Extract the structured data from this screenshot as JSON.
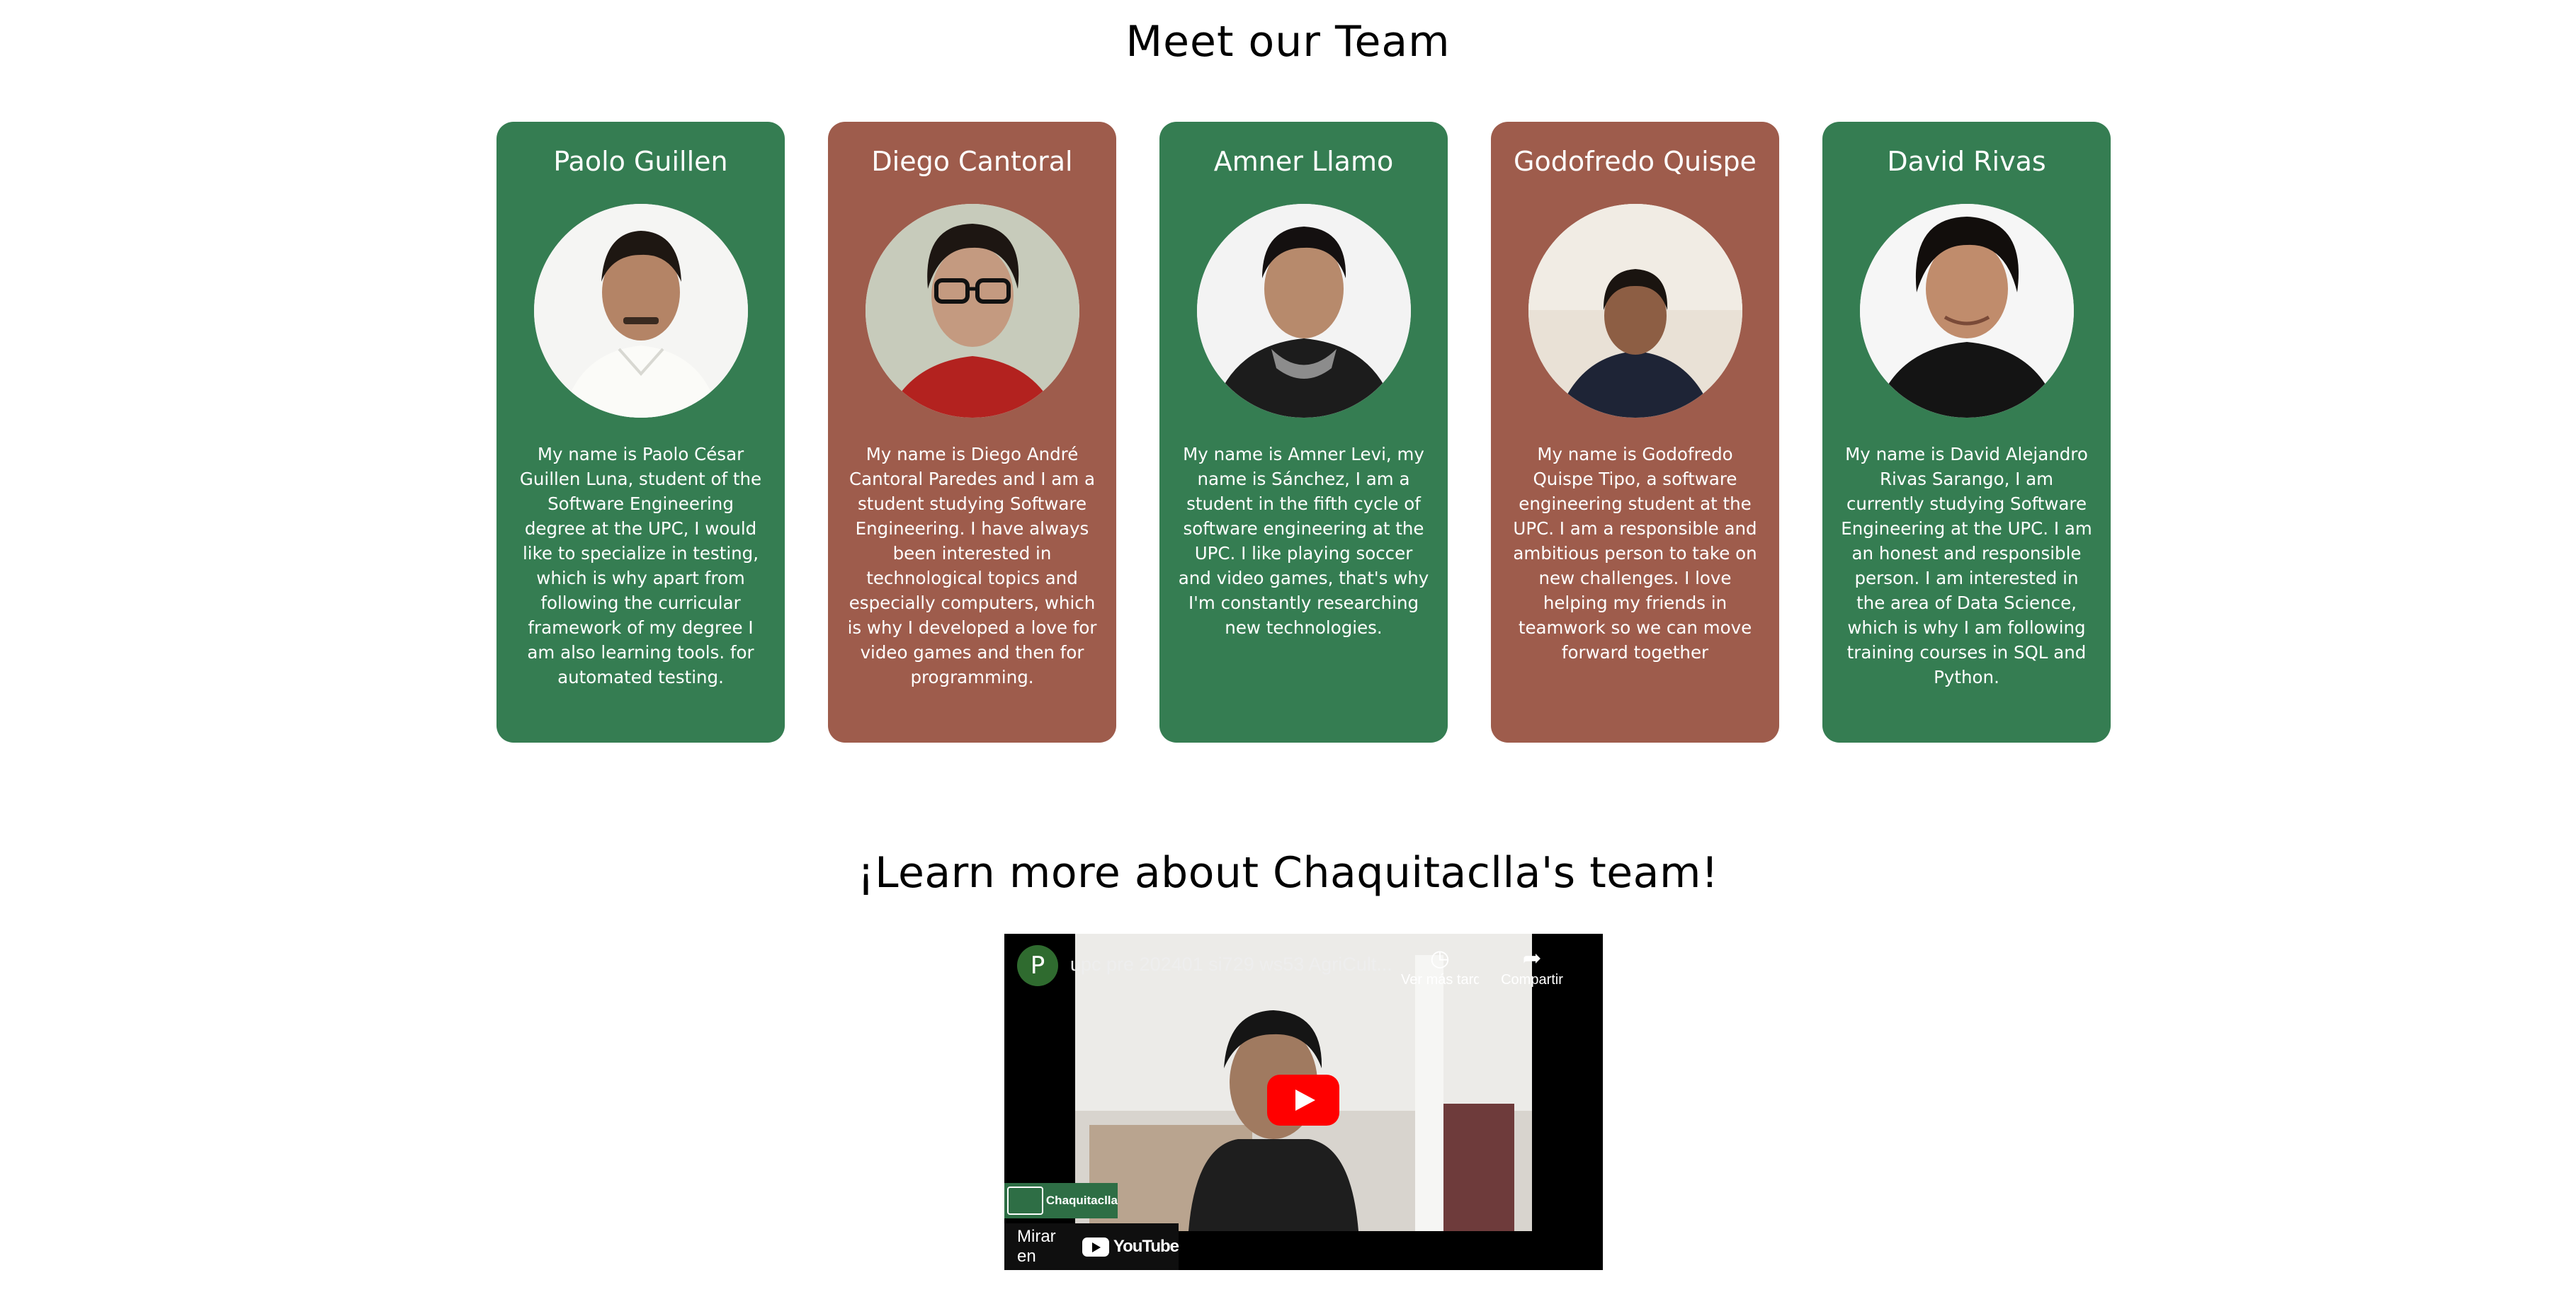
{
  "team_section": {
    "title": "Meet our Team",
    "members": [
      {
        "name": "Paolo Guillen",
        "bio": "My name is Paolo César Guillen Luna, student of the Software Engineering degree at the UPC, I would like to specialize in testing, which is why apart from following the curricular framework of my degree I am also learning tools. for automated testing.",
        "color": "#357d52"
      },
      {
        "name": "Diego Cantoral",
        "bio": "My name is Diego André Cantoral Paredes and I am a student studying Software Engineering. I have always been interested in technological topics and especially computers, which is why I developed a love for video games and then for programming.",
        "color": "#9e5c4c"
      },
      {
        "name": "Amner Llamo",
        "bio": "My name is Amner Levi, my name is Sánchez, I am a student in the fifth cycle of software engineering at the UPC. I like playing soccer and video games, that's why I'm constantly researching new technologies.",
        "color": "#357d52"
      },
      {
        "name": "Godofredo Quispe",
        "bio": "My name is Godofredo Quispe Tipo, a software engineering student at the UPC. I am a responsible and ambitious person to take on new challenges. I love helping my friends in teamwork so we can move forward together",
        "color": "#9e5c4c"
      },
      {
        "name": "David Rivas",
        "bio": "My name is David Alejandro Rivas Sarango, I am currently studying Software Engineering at the UPC. I am an honest and responsible person. I am interested in the area of Data Science, which is why I am following training courses in SQL and Python.",
        "color": "#357d52"
      }
    ]
  },
  "video_section": {
    "title": "¡Learn more about Chaquitaclla's team!",
    "player": {
      "channel_initial": "P",
      "video_title": "upc pre 202401 si729 ws53 AgriCult...",
      "watch_later_label": "Ver más tarde",
      "share_label": "Compartir",
      "brand_badge": "Chaquitaclla",
      "watch_on_label": "Mirar en",
      "youtube_label": "YouTube"
    }
  }
}
